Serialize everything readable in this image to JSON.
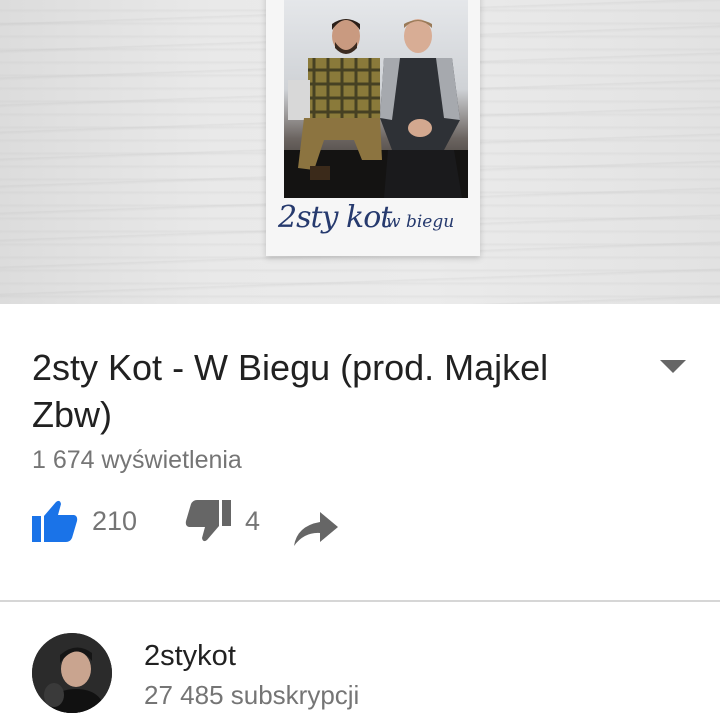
{
  "thumbnail": {
    "caption_main": "2sty kot",
    "caption_sub": "w biegu"
  },
  "video": {
    "title": "2sty Kot - W Biegu (prod. Majkel Zbw)",
    "views": "1 674 wyświetlenia",
    "likes": "210",
    "dislikes": "4"
  },
  "icons": {
    "like": "thumb-up-icon",
    "dislike": "thumb-down-icon",
    "share": "share-arrow-icon",
    "expand": "caret-down-icon"
  },
  "colors": {
    "like_active": "#1a73e8",
    "icon_inactive": "#666666",
    "divider": "#d6d6d6"
  },
  "channel": {
    "name": "2stykot",
    "subscribers": "27 485 subskrypcji"
  }
}
